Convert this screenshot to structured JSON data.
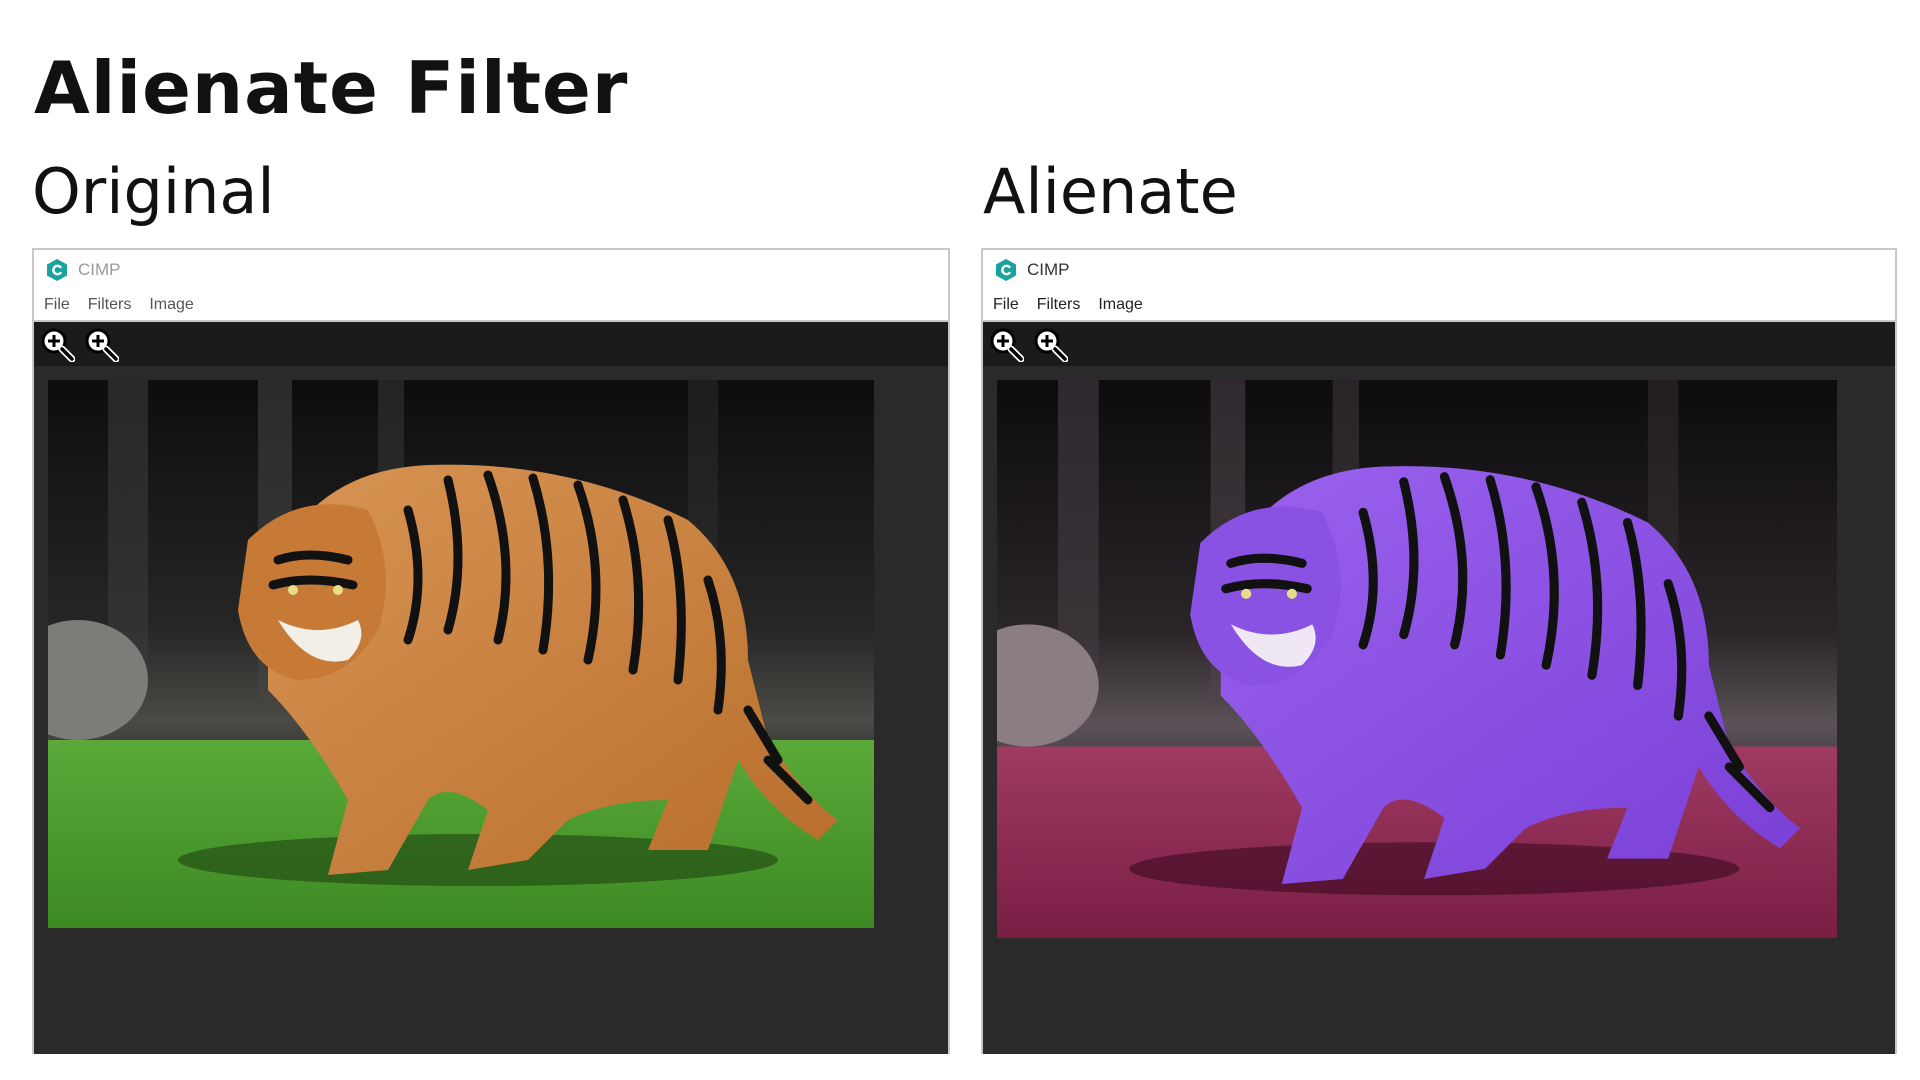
{
  "page": {
    "title": "Alienate Filter"
  },
  "panels": [
    {
      "heading": "Original",
      "window": {
        "app_title": "CIMP",
        "menu": [
          "File",
          "Filters",
          "Image"
        ],
        "toolbar": [
          "zoom-in-icon",
          "zoom-out-icon"
        ],
        "image": {
          "subject": "tiger-photo",
          "fur_color": "#c9823e",
          "ground_color": "#4f9a2c"
        }
      }
    },
    {
      "heading": "Alienate",
      "window": {
        "app_title": "CIMP",
        "menu": [
          "File",
          "Filters",
          "Image"
        ],
        "toolbar": [
          "zoom-in-icon",
          "zoom-out-icon"
        ],
        "image": {
          "subject": "tiger-photo-alienated",
          "fur_color": "#8a4fe0",
          "ground_color": "#9b2a5a"
        }
      }
    }
  ],
  "colors": {
    "logo": "#1aa39c",
    "canvas_bg": "#2a2a2a",
    "toolbar_bg": "#1b1b1b"
  }
}
